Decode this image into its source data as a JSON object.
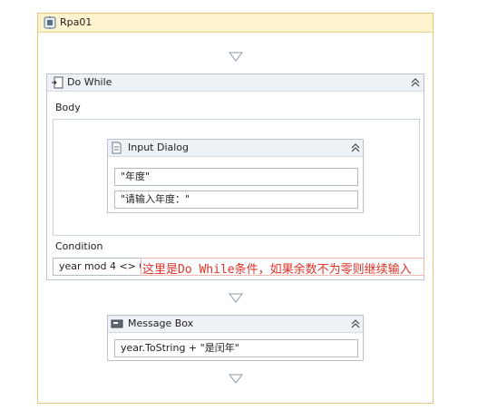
{
  "sequence": {
    "title": "Rpa01"
  },
  "do_while": {
    "title": "Do While",
    "body_label": "Body",
    "condition_label": "Condition",
    "condition_value": "year mod 4 <> 0"
  },
  "input_dialog": {
    "title": "Input Dialog",
    "field1": "\"年度\"",
    "field2": " \"请输入年度：\""
  },
  "message_box": {
    "title": "Message Box",
    "field1": "year.ToString + \"是闰年\""
  },
  "annotation": {
    "text": "这里是Do While条件，如果余数不为零则继续输入"
  },
  "colors": {
    "annotation": "#e0322a",
    "sequence_border": "#e4c77a",
    "card_border": "#b9c3cf"
  },
  "icons": [
    "sequence-icon",
    "do-while-icon",
    "input-dialog-icon",
    "message-box-icon",
    "collapse-icon",
    "drop-arrow-icon"
  ]
}
